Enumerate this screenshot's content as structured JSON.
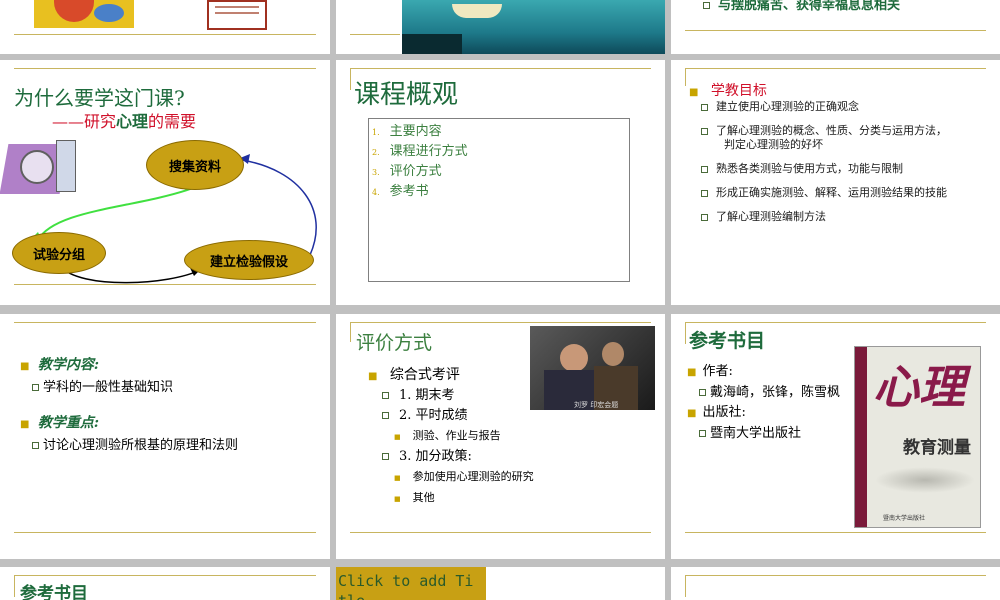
{
  "row1": {
    "s3_text": "与摆脱痛苦、获得幸福息息相关"
  },
  "s1": {
    "title": "为什么要学这门课?",
    "sub_prefix": "——研究",
    "sub_keyword": "心理",
    "sub_suffix": "的需要",
    "nodes": [
      "搜集资料",
      "试验分组",
      "建立检验假设"
    ]
  },
  "s2": {
    "title": "课程概观",
    "items": [
      {
        "num": "1.",
        "text": "主要内容"
      },
      {
        "num": "2.",
        "text": "课程进行方式"
      },
      {
        "num": "3.",
        "text": "评价方式"
      },
      {
        "num": "4.",
        "text": "参考书"
      }
    ]
  },
  "s3": {
    "heading": "学教目标",
    "items": [
      "建立使用心理测验的正确观念",
      "了解心理测验的概念、性质、分类与运用方法，",
      "判定心理测验的好坏",
      "熟悉各类测验与使用方式，功能与限制",
      "形成正确实施测验、解释、运用测验结果的技能",
      "了解心理测验编制方法"
    ]
  },
  "s4": {
    "h1": "教学内容:",
    "i1": "学科的一般性基础知识",
    "h2": "教学重点:",
    "i2": "讨论心理测验所根基的原理和法则"
  },
  "s5": {
    "title": "评价方式",
    "main": "综合式考评",
    "l1": "1. 期末考",
    "l2": "2. 平时成绩",
    "l2a": "测验、作业与报告",
    "l3": "3. 加分政策:",
    "l3a": "参加使用心理测验的研究",
    "l3b": "其他",
    "photo_caption": "刘罗 印宏会题"
  },
  "s6": {
    "title": "参考书目",
    "author_label": "作者:",
    "authors": "戴海崎，张锋，陈雪枫",
    "publisher_label": "出版社:",
    "publisher": "暨南大学出版社",
    "book_big": "心理",
    "book_title": "教育测量",
    "book_footer": "暨南大学出版社"
  },
  "row4": {
    "s1_title": "参考书目",
    "placeholder": "Click to add Ti tle"
  },
  "colors": {
    "accent": "#c8b560",
    "green": "#1e6b3c",
    "red": "#d0102a",
    "ellipse": "#c8a014"
  }
}
